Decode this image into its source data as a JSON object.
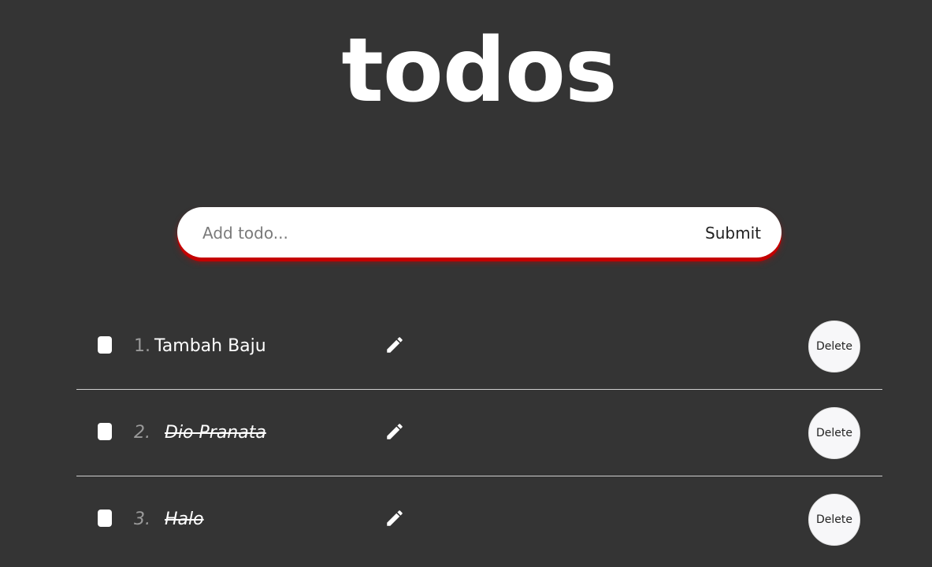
{
  "header": {
    "title": "todos"
  },
  "form": {
    "placeholder": "Add todo...",
    "value": "",
    "submit_label": "Submit"
  },
  "icons": {
    "edit": "pencil-icon"
  },
  "colors": {
    "background": "#343434",
    "form_shadow": "#c40000",
    "text": "#ffffff",
    "number": "#9a9a9a"
  },
  "todos": [
    {
      "number": "1.",
      "text": "Tambah Baju",
      "completed": false,
      "delete_label": "Delete"
    },
    {
      "number": "2.",
      "text": "Dio Pranata",
      "completed": true,
      "delete_label": "Delete"
    },
    {
      "number": "3.",
      "text": "Halo",
      "completed": true,
      "delete_label": "Delete"
    }
  ]
}
